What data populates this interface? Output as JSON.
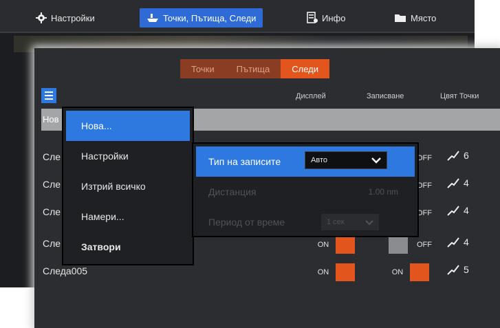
{
  "top_bar": {
    "settings": {
      "label": "Настройки",
      "icon": "gear-icon"
    },
    "points_routes_tracks": {
      "label": "Точки, Пътища, Следи",
      "icon": "boat-icon"
    },
    "info": {
      "label": "Инфо",
      "icon": "info-panel-icon"
    },
    "place": {
      "label": "Място",
      "icon": "folder-icon"
    }
  },
  "dialog": {
    "tabs": [
      {
        "label": "Точки",
        "active": false
      },
      {
        "label": "Пътища",
        "active": false
      },
      {
        "label": "Следи",
        "active": true
      }
    ],
    "columns": {
      "display": "Дисплей",
      "record": "Записване",
      "color_points": "Цвят Точки"
    },
    "new_row_label": "Нов",
    "rows": [
      {
        "name": "Сле",
        "display": "",
        "record": "OFF",
        "count": "6"
      },
      {
        "name": "Сле",
        "display": "",
        "record": "OFF",
        "count": "4"
      },
      {
        "name": "Сле",
        "display": "",
        "record": "OFF",
        "count": "4"
      },
      {
        "name": "Сле",
        "display": "ON",
        "record": "OFF",
        "count": "4"
      },
      {
        "name": "Следа005",
        "display": "ON",
        "record": "ON",
        "count": "5"
      }
    ]
  },
  "popup_menu": {
    "items": [
      {
        "label": "Нова...",
        "selected": true
      },
      {
        "label": "Настройки"
      },
      {
        "label": "Изтрий всичко"
      },
      {
        "label": "Намери..."
      },
      {
        "label": "Затвори",
        "bold": true
      }
    ]
  },
  "submenu": {
    "record_type": {
      "label": "Тип на записите",
      "value": "Авто"
    },
    "distance": {
      "label": "Дистанция",
      "value": "1.00 nm"
    },
    "time_period": {
      "label": "Период от време",
      "value": "1 сек"
    }
  },
  "colors": {
    "accent_blue": "#2e79e0",
    "accent_orange": "#e2561e",
    "tab_inactive": "#8a3d22",
    "panel_bg": "#2b2d31"
  }
}
